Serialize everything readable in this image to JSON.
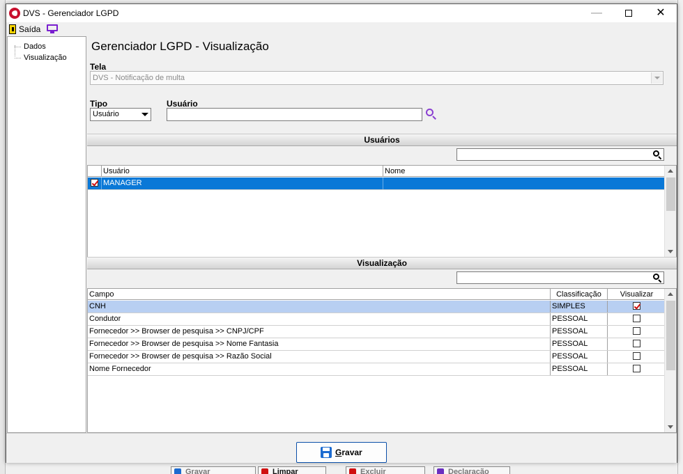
{
  "window": {
    "title": "DVS - Gerenciador LGPD"
  },
  "toolbar": {
    "exit_label": "Saída"
  },
  "nav": {
    "items": [
      {
        "label": "Dados"
      },
      {
        "label": "Visualização"
      }
    ]
  },
  "page": {
    "title": "Gerenciador LGPD - Visualização"
  },
  "form": {
    "tela_label": "Tela",
    "tela_value": "DVS - Notificação de multa",
    "tipo_label": "Tipo",
    "tipo_value": "Usuário",
    "usuario_label": "Usuário",
    "usuario_value": ""
  },
  "users_section": {
    "title": "Usuários",
    "filter_value": "",
    "columns": [
      "Usuário",
      "Nome"
    ],
    "rows": [
      {
        "checked": true,
        "usuario": "MANAGER",
        "nome": ""
      }
    ]
  },
  "view_section": {
    "title": "Visualização",
    "filter_value": "",
    "columns": [
      "Campo",
      "Classificação",
      "Visualizar"
    ],
    "rows": [
      {
        "campo": "CNH",
        "classificacao": "SIMPLES",
        "visualizar": true
      },
      {
        "campo": "Condutor",
        "classificacao": "PESSOAL",
        "visualizar": false
      },
      {
        "campo": "Fornecedor >> Browser de pesquisa >> CNPJ/CPF",
        "classificacao": "PESSOAL",
        "visualizar": false
      },
      {
        "campo": "Fornecedor >> Browser de pesquisa >> Nome Fantasia",
        "classificacao": "PESSOAL",
        "visualizar": false
      },
      {
        "campo": "Fornecedor >> Browser de pesquisa >> Razão Social",
        "classificacao": "PESSOAL",
        "visualizar": false
      },
      {
        "campo": "Nome Fornecedor",
        "classificacao": "PESSOAL",
        "visualizar": false
      }
    ]
  },
  "footer": {
    "save_label_first": "G",
    "save_label_rest": "ravar"
  },
  "background_app": {
    "buttons": [
      "Gravar",
      "Limpar",
      "Excluir",
      "Declaração"
    ]
  },
  "colors": {
    "selection_blue": "#0a78d7",
    "selection_light": "#b8cff2",
    "accent_purple": "#8a3fd1",
    "check_red": "#d01010"
  }
}
